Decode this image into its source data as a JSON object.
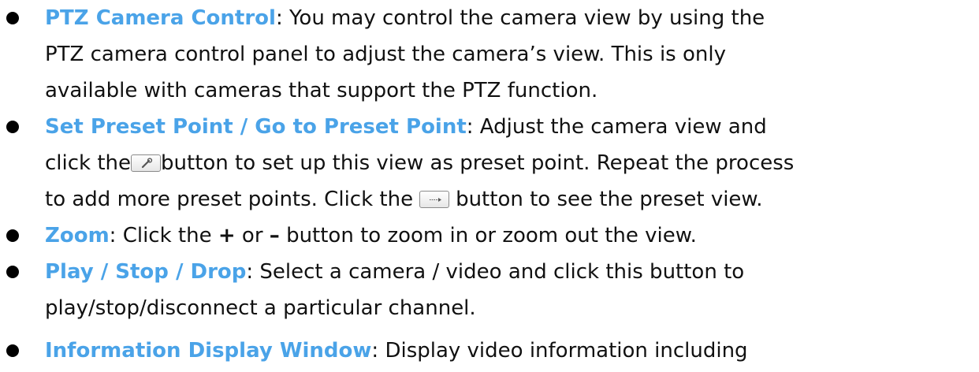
{
  "items": [
    {
      "term": "PTZ Camera Control",
      "lines": [
        ": You may control the camera view by using the",
        "PTZ camera control panel to adjust the camera’s view. This is only",
        "available with cameras that support the PTZ function."
      ]
    },
    {
      "term": "Set Preset Point / Go to Preset Point",
      "line1_rest": ": Adjust the camera view and",
      "line2_before": "click the",
      "line2_icon": "wrench-icon",
      "line2_after": "button to set up this view as preset point. Repeat the process",
      "line3_before": "to add more preset points. Click the",
      "line3_icon": "arrow-right-icon",
      "line3_after": "button to see the preset view."
    },
    {
      "term": "Zoom",
      "text1": ": Click the",
      "plus": "+",
      "text2": "or",
      "minus": "–",
      "text3": "button to zoom in or zoom out the view."
    },
    {
      "term": "Play / Stop / Drop",
      "lines": [
        ": Select a camera / video and click this button to",
        "play/stop/disconnect a particular channel."
      ]
    },
    {
      "term": "Information Display Window",
      "lines": [
        ": Display video information including"
      ]
    }
  ],
  "colors": {
    "term": "#4aa3e8",
    "text": "#111111"
  }
}
